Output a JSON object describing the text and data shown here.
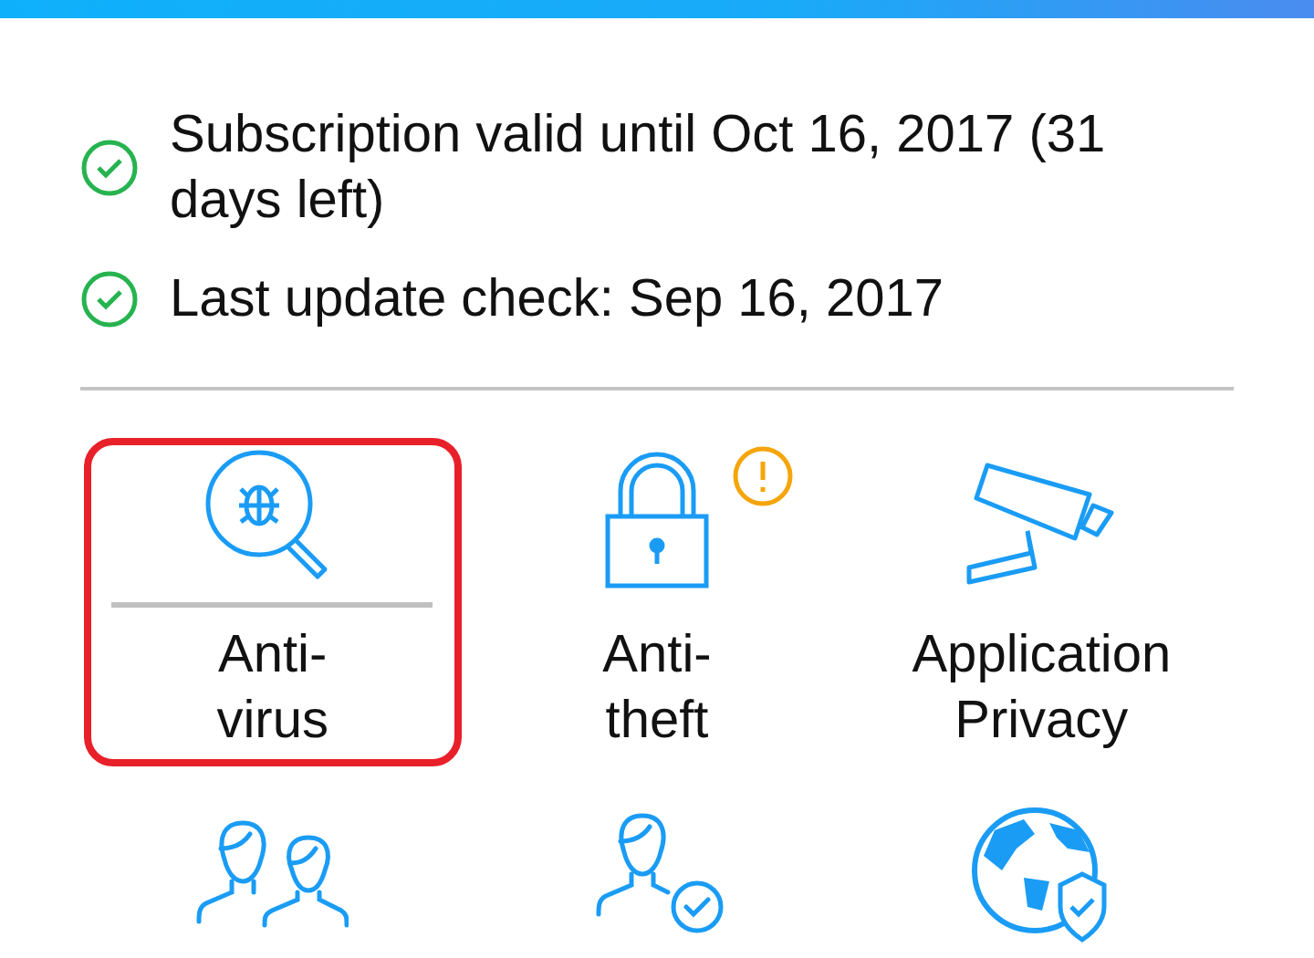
{
  "status": [
    {
      "text": "Subscription valid until Oct 16, 2017 (31 days left)",
      "ok": true
    },
    {
      "text": "Last update check: Sep 16, 2017",
      "ok": true
    }
  ],
  "features": [
    {
      "kind": "antivirus",
      "label": "Anti-virus",
      "selected": true,
      "warning": false
    },
    {
      "kind": "antitheft",
      "label": "Anti-theft",
      "selected": false,
      "warning": true
    },
    {
      "kind": "privacy",
      "label": "Application Privacy",
      "selected": false,
      "warning": false
    },
    {
      "kind": "people",
      "selected": false,
      "warning": false
    },
    {
      "kind": "person-check",
      "selected": false,
      "warning": false
    },
    {
      "kind": "globe",
      "selected": false,
      "warning": false
    }
  ]
}
